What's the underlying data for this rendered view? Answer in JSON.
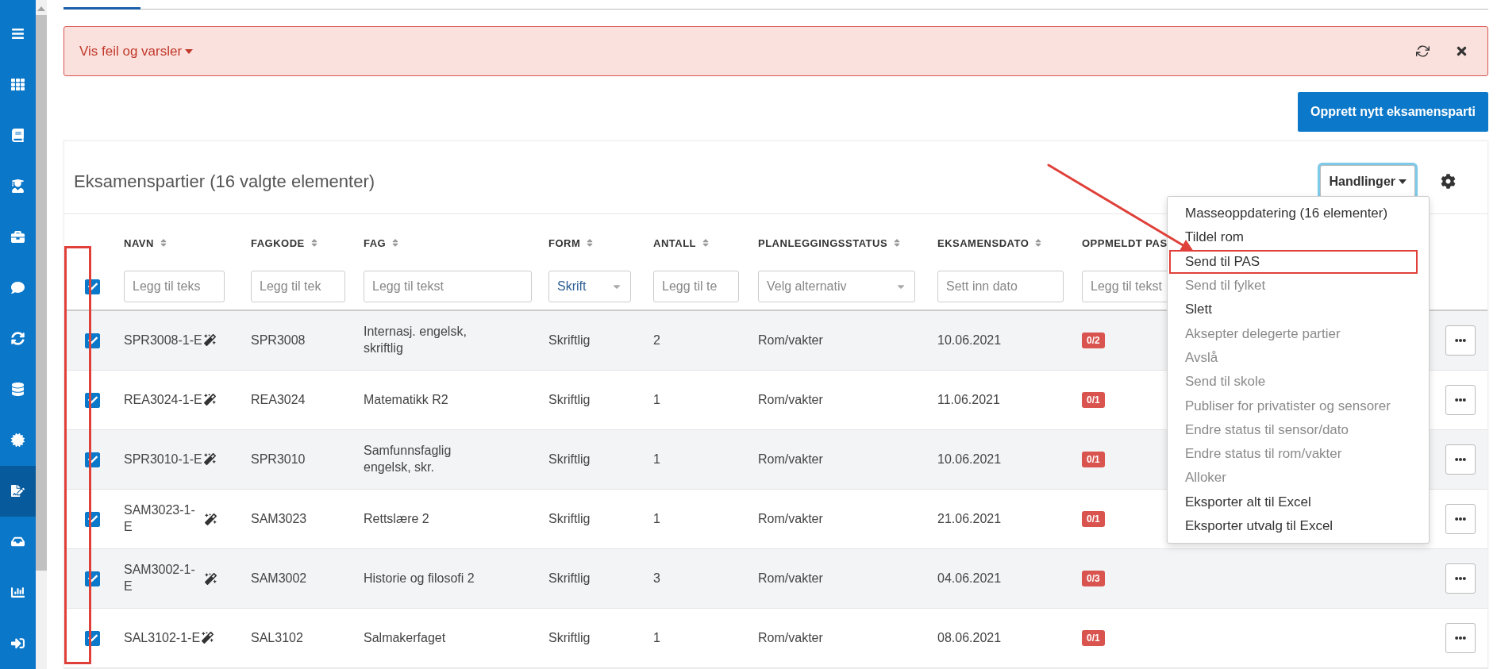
{
  "sidebar": {
    "items": [
      {
        "selected": false
      },
      {
        "selected": false
      },
      {
        "selected": false
      },
      {
        "selected": false
      },
      {
        "selected": false
      },
      {
        "selected": false
      },
      {
        "selected": false
      },
      {
        "selected": false
      },
      {
        "selected": false
      },
      {
        "selected": true
      },
      {
        "selected": false
      },
      {
        "selected": false
      },
      {
        "selected": false
      }
    ]
  },
  "alert": {
    "label": "Vis feil og varsler"
  },
  "create_button": "Opprett nytt eksamensparti",
  "card": {
    "title": "Eksamenspartier (16 valgte elementer)",
    "actions_button": "Handlinger",
    "actions_focused": true
  },
  "table": {
    "select_all": {
      "checked": true
    },
    "columns": [
      {
        "label": "NAVN",
        "filter": {
          "kind": "text",
          "placeholder": "Legg til teks"
        }
      },
      {
        "label": "FAGKODE",
        "filter": {
          "kind": "text",
          "placeholder": "Legg til tek"
        }
      },
      {
        "label": "FAG",
        "filter": {
          "kind": "text",
          "placeholder": "Legg til tekst"
        }
      },
      {
        "label": "FORM",
        "filter": {
          "kind": "select",
          "value": "Skrift"
        }
      },
      {
        "label": "ANTALL",
        "filter": {
          "kind": "text",
          "placeholder": "Legg til te"
        }
      },
      {
        "label": "PLANLEGGINGSSTATUS",
        "filter": {
          "kind": "select",
          "placeholder": "Velg alternativ"
        }
      },
      {
        "label": "EKSAMENSDATO",
        "filter": {
          "kind": "text",
          "placeholder": "Sett inn dato"
        }
      },
      {
        "label": "OPPMELDT PAS",
        "filter": {
          "kind": "text",
          "placeholder": "Legg til tekst"
        }
      }
    ],
    "rows": [
      {
        "checked": true,
        "name": "SPR3008-1-E",
        "code": "SPR3008",
        "subject": "Internasj. engelsk, skriftlig",
        "form": "Skriftlig",
        "count": "2",
        "status": "Rom/vakter",
        "date": "10.06.2021",
        "registered": "0/2"
      },
      {
        "checked": true,
        "name": "REA3024-1-E",
        "code": "REA3024",
        "subject": "Matematikk R2",
        "form": "Skriftlig",
        "count": "1",
        "status": "Rom/vakter",
        "date": "11.06.2021",
        "registered": "0/1"
      },
      {
        "checked": true,
        "name": "SPR3010-1-E",
        "code": "SPR3010",
        "subject": "Samfunnsfaglig engelsk, skr.",
        "form": "Skriftlig",
        "count": "1",
        "status": "Rom/vakter",
        "date": "10.06.2021",
        "registered": "0/1"
      },
      {
        "checked": true,
        "name": "SAM3023-1-E",
        "code": "SAM3023",
        "subject": "Rettslære 2",
        "form": "Skriftlig",
        "count": "1",
        "status": "Rom/vakter",
        "date": "21.06.2021",
        "registered": "0/1"
      },
      {
        "checked": true,
        "name": "SAM3002-1-E",
        "code": "SAM3002",
        "subject": "Historie og filosofi 2",
        "form": "Skriftlig",
        "count": "3",
        "status": "Rom/vakter",
        "date": "04.06.2021",
        "registered": "0/3"
      },
      {
        "checked": true,
        "name": "SAL3102-1-E",
        "code": "SAL3102",
        "subject": "Salmakerfaget",
        "form": "Skriftlig",
        "count": "1",
        "status": "Rom/vakter",
        "date": "08.06.2021",
        "registered": "0/1"
      }
    ]
  },
  "actions_menu": {
    "items": [
      {
        "label": "Masseoppdatering (16 elementer)",
        "disabled": false,
        "outlined": false
      },
      {
        "label": "Tildel rom",
        "disabled": false,
        "outlined": false
      },
      {
        "label": "Send til PAS",
        "disabled": false,
        "outlined": true
      },
      {
        "label": "Send til fylket",
        "disabled": true,
        "outlined": false
      },
      {
        "label": "Slett",
        "disabled": false,
        "outlined": false
      },
      {
        "label": "Aksepter delegerte partier",
        "disabled": true,
        "outlined": false
      },
      {
        "label": "Avslå",
        "disabled": true,
        "outlined": false
      },
      {
        "label": "Send til skole",
        "disabled": true,
        "outlined": false
      },
      {
        "label": "Publiser for privatister og sensorer",
        "disabled": true,
        "outlined": false
      },
      {
        "label": "Endre status til sensor/dato",
        "disabled": true,
        "outlined": false
      },
      {
        "label": "Endre status til rom/vakter",
        "disabled": true,
        "outlined": false
      },
      {
        "label": "Alloker",
        "disabled": true,
        "outlined": false
      },
      {
        "label": "Eksporter alt til Excel",
        "disabled": false,
        "outlined": false
      },
      {
        "label": "Eksporter utvalg til Excel",
        "disabled": false,
        "outlined": false
      }
    ]
  },
  "annotations": {
    "arrow": true,
    "column_frame": true
  }
}
